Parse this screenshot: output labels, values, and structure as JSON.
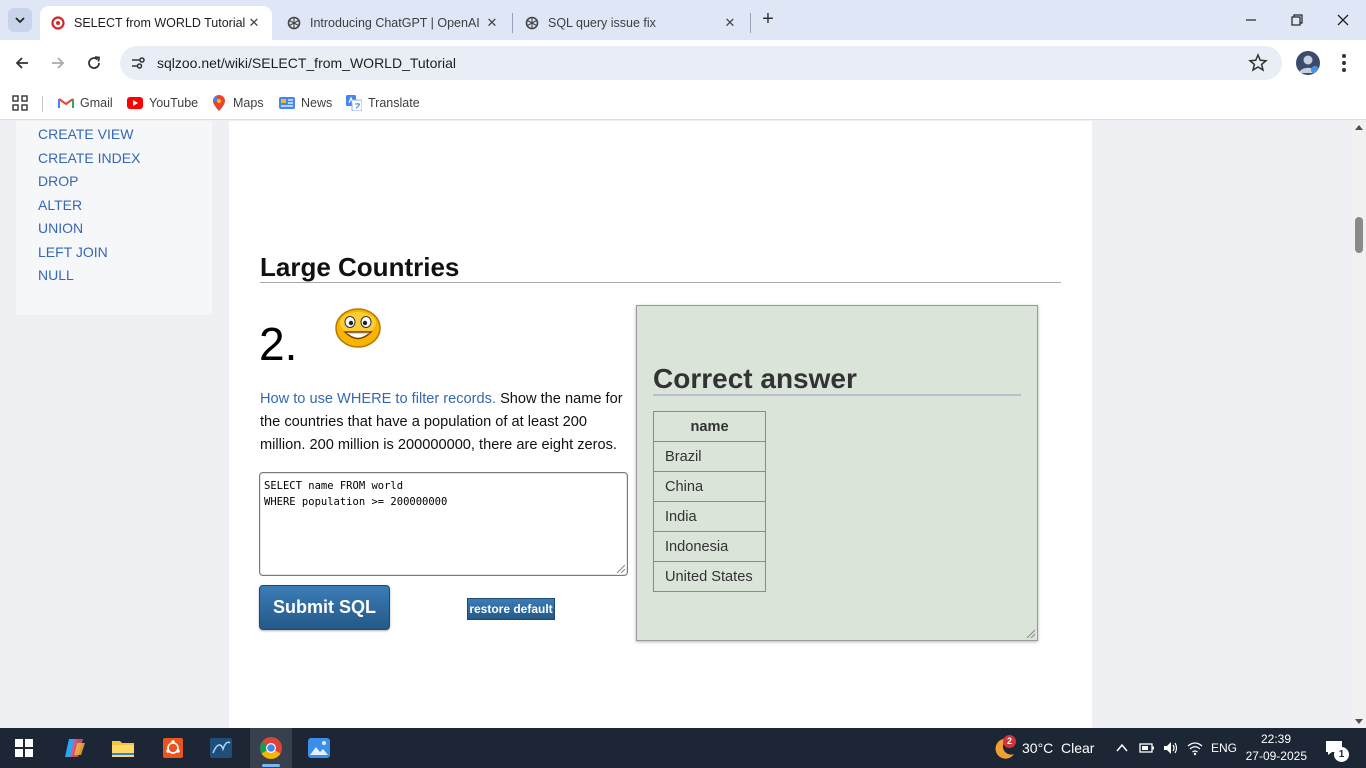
{
  "browser": {
    "tabs": [
      {
        "title": "SELECT from WORLD Tutorial -",
        "active": true
      },
      {
        "title": "Introducing ChatGPT | OpenAI",
        "active": false
      },
      {
        "title": "SQL query issue fix",
        "active": false
      }
    ],
    "url": "sqlzoo.net/wiki/SELECT_from_WORLD_Tutorial",
    "bookmarks": [
      "Gmail",
      "YouTube",
      "Maps",
      "News",
      "Translate"
    ]
  },
  "sidebar": {
    "items": [
      "CREATE VIEW",
      "CREATE INDEX",
      "DROP",
      "ALTER",
      "UNION",
      "LEFT JOIN",
      "NULL"
    ]
  },
  "main": {
    "section_title": "Large Countries",
    "question_number": "2.",
    "question_link": "How to use WHERE to filter records.",
    "question_text": " Show the name for the countries that have a population of at least 200 million. 200 million is 200000000, there are eight zeros.",
    "sql_lines": [
      "SELECT name FROM world",
      "WHERE population >= 200000000"
    ],
    "submit_label": "Submit SQL",
    "restore_label": "restore default",
    "answer": {
      "title": "Correct answer",
      "column": "name",
      "rows": [
        "Brazil",
        "China",
        "India",
        "Indonesia",
        "United States"
      ]
    }
  },
  "taskbar": {
    "weather_temp": "30°C",
    "weather_desc": "Clear",
    "weather_badge": "2",
    "lang": "ENG",
    "time": "22:39",
    "date": "27-09-2025",
    "notif_count": "1"
  },
  "colors": {
    "link": "#3568b4",
    "button": "#245987",
    "answer_panel": "#dae4d9",
    "tabstrip": "#dfe6f5"
  }
}
